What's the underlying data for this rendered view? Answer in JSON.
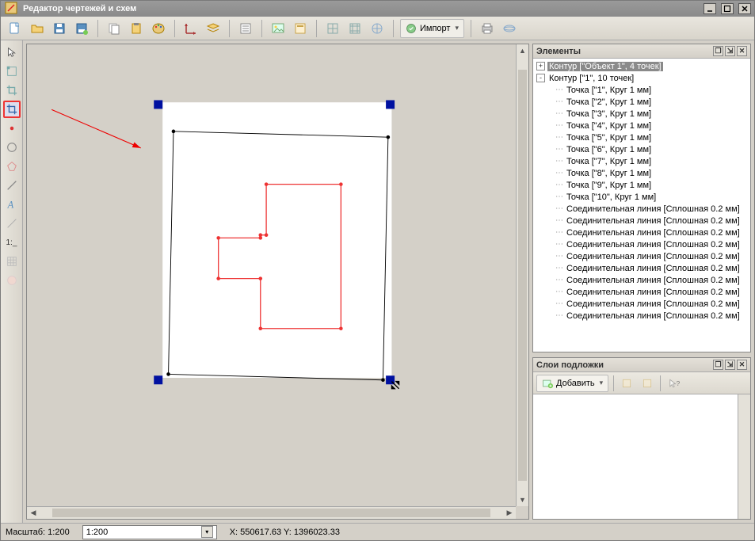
{
  "window": {
    "title": "Редактор чертежей и схем"
  },
  "toolbar": {
    "import_label": "Импорт"
  },
  "tools": {
    "text_label": "1:_"
  },
  "panels": {
    "elements": {
      "title": "Элементы",
      "items": [
        {
          "level": 0,
          "expander": "+",
          "label": "Контур [\"Объект 1\", 4 точек]",
          "selected": true
        },
        {
          "level": 0,
          "expander": "-",
          "label": "Контур [\"1\", 10 точек]"
        },
        {
          "level": 1,
          "label": "Точка [\"1\", Круг 1 мм]"
        },
        {
          "level": 1,
          "label": "Точка [\"2\", Круг 1 мм]"
        },
        {
          "level": 1,
          "label": "Точка [\"3\", Круг 1 мм]"
        },
        {
          "level": 1,
          "label": "Точка [\"4\", Круг 1 мм]"
        },
        {
          "level": 1,
          "label": "Точка [\"5\", Круг 1 мм]"
        },
        {
          "level": 1,
          "label": "Точка [\"6\", Круг 1 мм]"
        },
        {
          "level": 1,
          "label": "Точка [\"7\", Круг 1 мм]"
        },
        {
          "level": 1,
          "label": "Точка [\"8\", Круг 1 мм]"
        },
        {
          "level": 1,
          "label": "Точка [\"9\", Круг 1 мм]"
        },
        {
          "level": 1,
          "label": "Точка [\"10\", Круг 1 мм]"
        },
        {
          "level": 1,
          "label": "Соединительная линия [Сплошная 0.2 мм]"
        },
        {
          "level": 1,
          "label": "Соединительная линия [Сплошная 0.2 мм]"
        },
        {
          "level": 1,
          "label": "Соединительная линия [Сплошная 0.2 мм]"
        },
        {
          "level": 1,
          "label": "Соединительная линия [Сплошная 0.2 мм]"
        },
        {
          "level": 1,
          "label": "Соединительная линия [Сплошная 0.2 мм]"
        },
        {
          "level": 1,
          "label": "Соединительная линия [Сплошная 0.2 мм]"
        },
        {
          "level": 1,
          "label": "Соединительная линия [Сплошная 0.2 мм]"
        },
        {
          "level": 1,
          "label": "Соединительная линия [Сплошная 0.2 мм]"
        },
        {
          "level": 1,
          "label": "Соединительная линия [Сплошная 0.2 мм]"
        },
        {
          "level": 1,
          "label": "Соединительная линия [Сплошная 0.2 мм]"
        }
      ]
    },
    "layers": {
      "title": "Слои подложки",
      "add_label": "Добавить"
    }
  },
  "status": {
    "scale_label": "Масштаб: 1:200",
    "scale_value": "1:200",
    "coords": "X: 550617.63 Y: 1396023.33"
  }
}
